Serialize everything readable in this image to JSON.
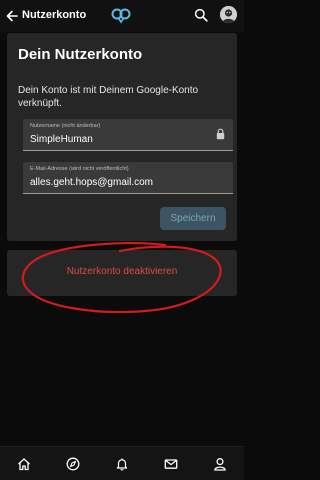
{
  "header": {
    "title": "Nutzerkonto",
    "icons": [
      "arrow-left-icon",
      "app-logo-icon",
      "search-icon",
      "avatar"
    ]
  },
  "account": {
    "title": "Dein Nutzerkonto",
    "description": "Dein Konto ist mit Deinem Google-Konto verknüpft.",
    "username_label": "Nutzername (nicht änderbar)",
    "username_value": "SimpleHuman",
    "email_label": "E-Mail-Adresse (wird nicht veröffentlicht)",
    "email_value": "alles.geht.hops@gmail.com",
    "save_label": "Speichern"
  },
  "deactivate": {
    "label": "Nutzerkonto deaktivieren"
  },
  "bottom_nav": {
    "items": [
      "home-icon",
      "compass-icon",
      "bell-icon",
      "mail-icon",
      "user-icon"
    ]
  },
  "colors": {
    "background": "#0b0b0b",
    "card": "#262626",
    "field": "#3a3a3a",
    "accent_button": "#3d5563",
    "accent_text": "#7aa6bb",
    "danger": "#e04848",
    "logo": "#5fb8e6",
    "annotation_red": "#d21b1b"
  }
}
